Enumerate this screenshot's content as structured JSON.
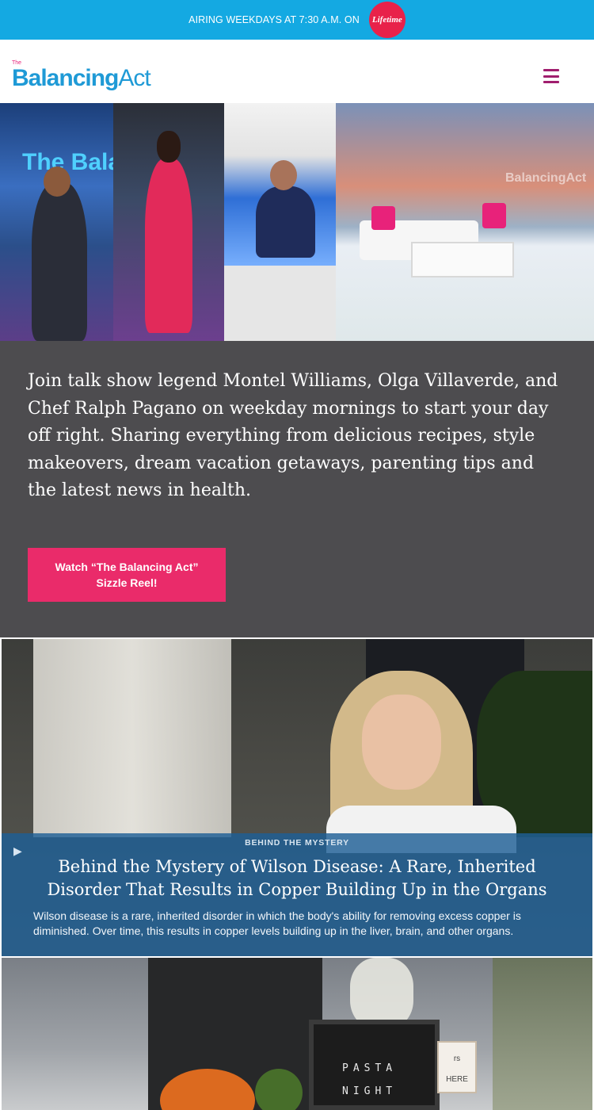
{
  "airing_bar": {
    "text": "AIRING WEEKDAYS AT 7:30 A.M. ON",
    "network_logo_text": "Lifetime"
  },
  "header": {
    "logo_small": "The",
    "logo_part1": "Balancing",
    "logo_part2": "Act",
    "menu_icon": "hamburger-icon"
  },
  "hero": {
    "panel1_logo_text": "The Balancin",
    "panel4_logo_text": "BalancingAct"
  },
  "intro": {
    "text": "Join talk show legend Montel Williams, Olga Villaverde, and Chef Ralph Pagano on weekday mornings to start your day off right. Sharing everything from delicious recipes, style makeovers, dream vacation getaways, parenting tips and the latest news in health.",
    "button_label": "Watch “The Balancing Act” Sizzle Reel!"
  },
  "feature": {
    "play_icon": "play-icon",
    "category": "BEHIND THE MYSTERY",
    "title": "Behind the Mystery of Wilson Disease: A Rare, Inherited Disorder That Results in Copper Building Up in the Organs",
    "description": "Wilson disease is a rare, inherited disorder in which the body's ability for removing excess copper is diminished. Over time, this results in copper levels building up in the liver, brain, and other organs."
  },
  "feature2": {
    "board_line1": "PASTA",
    "board_line2": "NIGHT",
    "sign_line1": "rs",
    "sign_line2": "HERE"
  },
  "colors": {
    "airing_bar_bg": "#14a9e2",
    "brand_blue": "#1f9ad6",
    "brand_pink": "#ea2b6a",
    "intro_bg": "#4d4c4f",
    "menu_icon": "#a01e6e"
  }
}
